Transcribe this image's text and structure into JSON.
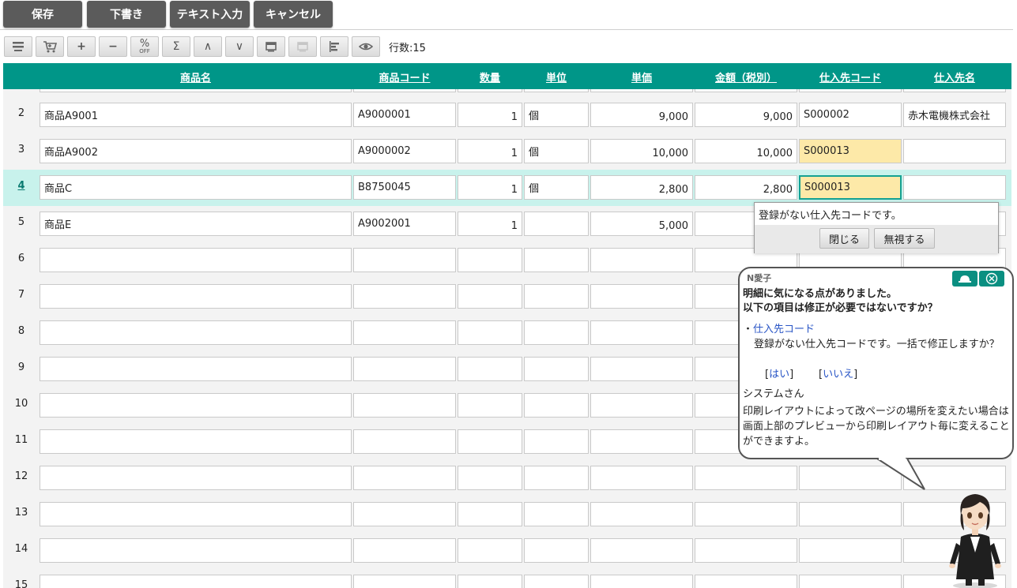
{
  "toolbar": {
    "save": "保存",
    "draft": "下書き",
    "text_input": "テキスト入力",
    "cancel": "キャンセル"
  },
  "icons": [
    "list-icon",
    "cart-icon",
    "plus-icon",
    "minus-icon",
    "percent-off-icon",
    "sigma-icon",
    "caret-up-icon",
    "caret-down-icon",
    "window-icon",
    "window-disabled-icon",
    "bar-align-icon",
    "eye-icon"
  ],
  "icon_labels": {
    "plus": "+",
    "minus": "−",
    "sigma": "Σ",
    "up": "∧",
    "down": "∨",
    "percent": "%",
    "off": "OFF"
  },
  "row_count": "行数:15",
  "columns": {
    "name": "商品名",
    "code": "商品コード",
    "qty": "数量",
    "unit": "単位",
    "price": "単価",
    "amount": "金額（税別）",
    "supplier_code": "仕入先コード",
    "supplier_name": "仕入先名"
  },
  "rows": [
    {
      "no": "2",
      "name": "商品A9001",
      "code": "A9000001",
      "qty": "1",
      "unit": "個",
      "price": "9,000",
      "amount": "9,000",
      "supplier_code": "S000002",
      "supplier_name": "赤木電機株式会社"
    },
    {
      "no": "3",
      "name": "商品A9002",
      "code": "A9000002",
      "qty": "1",
      "unit": "個",
      "price": "10,000",
      "amount": "10,000",
      "supplier_code": "S000013",
      "supplier_name": ""
    },
    {
      "no": "4",
      "name": "商品C",
      "code": "B8750045",
      "qty": "1",
      "unit": "個",
      "price": "2,800",
      "amount": "2,800",
      "supplier_code": "S000013",
      "supplier_name": ""
    },
    {
      "no": "5",
      "name": "商品E",
      "code": "A9002001",
      "qty": "1",
      "unit": "",
      "price": "5,000",
      "amount": "",
      "supplier_code": "",
      "supplier_name": ""
    },
    {
      "no": "6"
    },
    {
      "no": "7"
    },
    {
      "no": "8"
    },
    {
      "no": "9"
    },
    {
      "no": "10"
    },
    {
      "no": "11"
    },
    {
      "no": "12"
    },
    {
      "no": "13"
    },
    {
      "no": "14"
    },
    {
      "no": "15"
    }
  ],
  "popup": {
    "message": "登録がない仕入先コードです。",
    "close": "閉じる",
    "ignore": "無視する"
  },
  "assistant": {
    "name": "N愛子",
    "title_line1": "明細に気になる点がありました。",
    "title_line2": "以下の項目は修正が必要ではないですか？",
    "bullet": "・",
    "item_label": "仕入先コード",
    "item_desc": "登録がない仕入先コードです。一括で修正しますか？",
    "yes_text": "はい",
    "no_text": "いいえ",
    "sys_name": "システムさん",
    "sys_message": "印刷レイアウトによって改ページの場所を変えたい場合は画面上部のプレビューから印刷レイアウト毎に変えることができますよ。"
  },
  "colors": {
    "header_teal": "#009688",
    "active_row": "#c8f2ec",
    "warn_cell": "#fde9a8",
    "toolbar_dark": "#5b5b5b"
  }
}
